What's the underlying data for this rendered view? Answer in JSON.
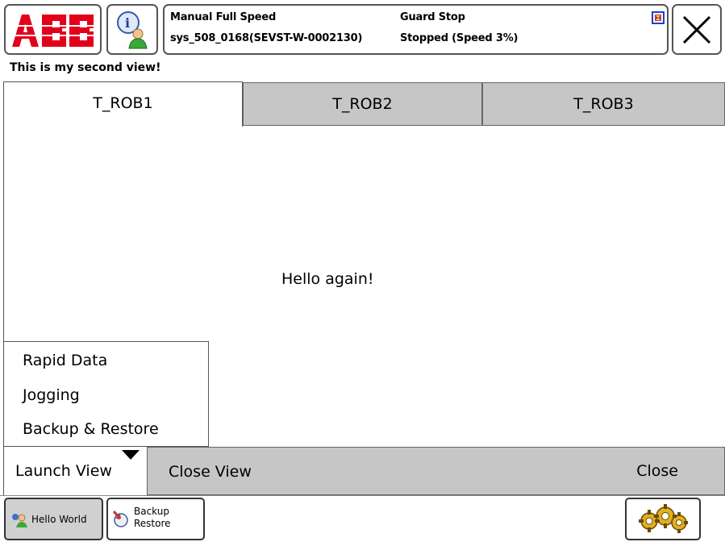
{
  "header": {
    "logo_text": "ABB",
    "status": {
      "mode": "Manual Full Speed",
      "state": "Guard Stop",
      "system": "sys_508_0168(SEVST-W-0002130)",
      "speed": "Stopped (Speed 3%)"
    }
  },
  "view_title": "This is my second view!",
  "tabs": [
    {
      "label": "T_ROB1",
      "active": true
    },
    {
      "label": "T_ROB2",
      "active": false
    },
    {
      "label": "T_ROB3",
      "active": false
    }
  ],
  "main": {
    "message": "Hello again!"
  },
  "launch_menu": {
    "items": [
      "Rapid Data",
      "Jogging",
      "Backup & Restore"
    ]
  },
  "command_bar": {
    "launch_view": "Launch View",
    "close_view": "Close View",
    "close": "Close"
  },
  "taskbar": {
    "items": [
      {
        "label": "Hello World",
        "icon": "users-icon",
        "active": true
      },
      {
        "label_line1": "Backup",
        "label_line2": "Restore",
        "icon": "backup-icon",
        "active": false
      }
    ],
    "settings_icon": "gears-icon"
  },
  "colors": {
    "abb_red": "#e2001a",
    "inactive_tab": "#c6c6c6",
    "status_icon_blue": "#1c3fd6"
  }
}
